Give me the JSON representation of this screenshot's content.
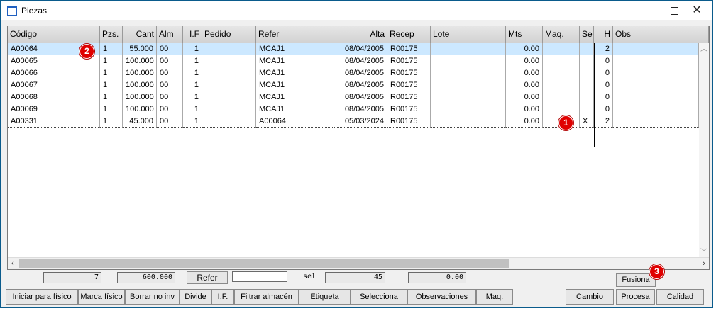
{
  "window": {
    "title": "Piezas"
  },
  "grid": {
    "columns": [
      {
        "key": "codigo",
        "label": "Código",
        "align": "l"
      },
      {
        "key": "pzs",
        "label": "Pzs.",
        "align": "l"
      },
      {
        "key": "cant",
        "label": "Cant",
        "align": "r"
      },
      {
        "key": "alm",
        "label": "Alm",
        "align": "l"
      },
      {
        "key": "if",
        "label": "I.F",
        "align": "r"
      },
      {
        "key": "pedido",
        "label": "Pedido",
        "align": "l"
      },
      {
        "key": "refer",
        "label": "Refer",
        "align": "l"
      },
      {
        "key": "alta",
        "label": "Alta",
        "align": "r"
      },
      {
        "key": "recep",
        "label": "Recep",
        "align": "l"
      },
      {
        "key": "lote",
        "label": "Lote",
        "align": "l"
      },
      {
        "key": "mts",
        "label": "Mts",
        "align": "l"
      },
      {
        "key": "maq",
        "label": "Maq.",
        "align": "l"
      },
      {
        "key": "se",
        "label": "Se",
        "align": "l"
      },
      {
        "key": "h",
        "label": "H",
        "align": "r"
      },
      {
        "key": "obs",
        "label": "Obs",
        "align": "l"
      }
    ],
    "rows": [
      {
        "codigo": "A00064",
        "pzs": "1",
        "cant": "55.000",
        "alm": "00",
        "if": "1",
        "pedido": "",
        "refer": "MCAJ1",
        "alta": "08/04/2005",
        "recep": "R00175",
        "lote": "",
        "mts": "0.00",
        "maq": "",
        "se": "",
        "h": "2",
        "obs": ""
      },
      {
        "codigo": "A00065",
        "pzs": "1",
        "cant": "100.000",
        "alm": "00",
        "if": "1",
        "pedido": "",
        "refer": "MCAJ1",
        "alta": "08/04/2005",
        "recep": "R00175",
        "lote": "",
        "mts": "0.00",
        "maq": "",
        "se": "",
        "h": "0",
        "obs": ""
      },
      {
        "codigo": "A00066",
        "pzs": "1",
        "cant": "100.000",
        "alm": "00",
        "if": "1",
        "pedido": "",
        "refer": "MCAJ1",
        "alta": "08/04/2005",
        "recep": "R00175",
        "lote": "",
        "mts": "0.00",
        "maq": "",
        "se": "",
        "h": "0",
        "obs": ""
      },
      {
        "codigo": "A00067",
        "pzs": "1",
        "cant": "100.000",
        "alm": "00",
        "if": "1",
        "pedido": "",
        "refer": "MCAJ1",
        "alta": "08/04/2005",
        "recep": "R00175",
        "lote": "",
        "mts": "0.00",
        "maq": "",
        "se": "",
        "h": "0",
        "obs": ""
      },
      {
        "codigo": "A00068",
        "pzs": "1",
        "cant": "100.000",
        "alm": "00",
        "if": "1",
        "pedido": "",
        "refer": "MCAJ1",
        "alta": "08/04/2005",
        "recep": "R00175",
        "lote": "",
        "mts": "0.00",
        "maq": "",
        "se": "",
        "h": "0",
        "obs": ""
      },
      {
        "codigo": "A00069",
        "pzs": "1",
        "cant": "100.000",
        "alm": "00",
        "if": "1",
        "pedido": "",
        "refer": "MCAJ1",
        "alta": "08/04/2005",
        "recep": "R00175",
        "lote": "",
        "mts": "0.00",
        "maq": "",
        "se": "",
        "h": "0",
        "obs": ""
      },
      {
        "codigo": "A00331",
        "pzs": "1",
        "cant": "45.000",
        "alm": "00",
        "if": "1",
        "pedido": "",
        "refer": "A00064",
        "alta": "05/03/2024",
        "recep": "R00175",
        "lote": "",
        "mts": "0.00",
        "maq": "",
        "se": "X",
        "h": "2",
        "obs": ""
      }
    ],
    "selected_row": 0
  },
  "totals": {
    "count": "7",
    "cant_total": "600.000",
    "refer_button": "Refer",
    "refer_input_value": "",
    "sel_label": "sel",
    "sel_value": "45",
    "mts_total": "0.00"
  },
  "buttons": {
    "fusiona": "Fusiona",
    "toolbar": [
      "Iniciar para físico",
      "Marca físico",
      "Borrar no inv",
      "Divide",
      "I.F.",
      "Filtrar almacén",
      "Etiqueta",
      "Selecciona",
      "Observaciones",
      "Maq."
    ],
    "cambio": "Cambio",
    "procesa": "Procesa",
    "calidad": "Calidad"
  },
  "badges": [
    "1",
    "2",
    "3"
  ],
  "colors": {
    "selected_row": "#cce8ff",
    "badge": "#e00000",
    "window_border": "#0a5b8c"
  }
}
